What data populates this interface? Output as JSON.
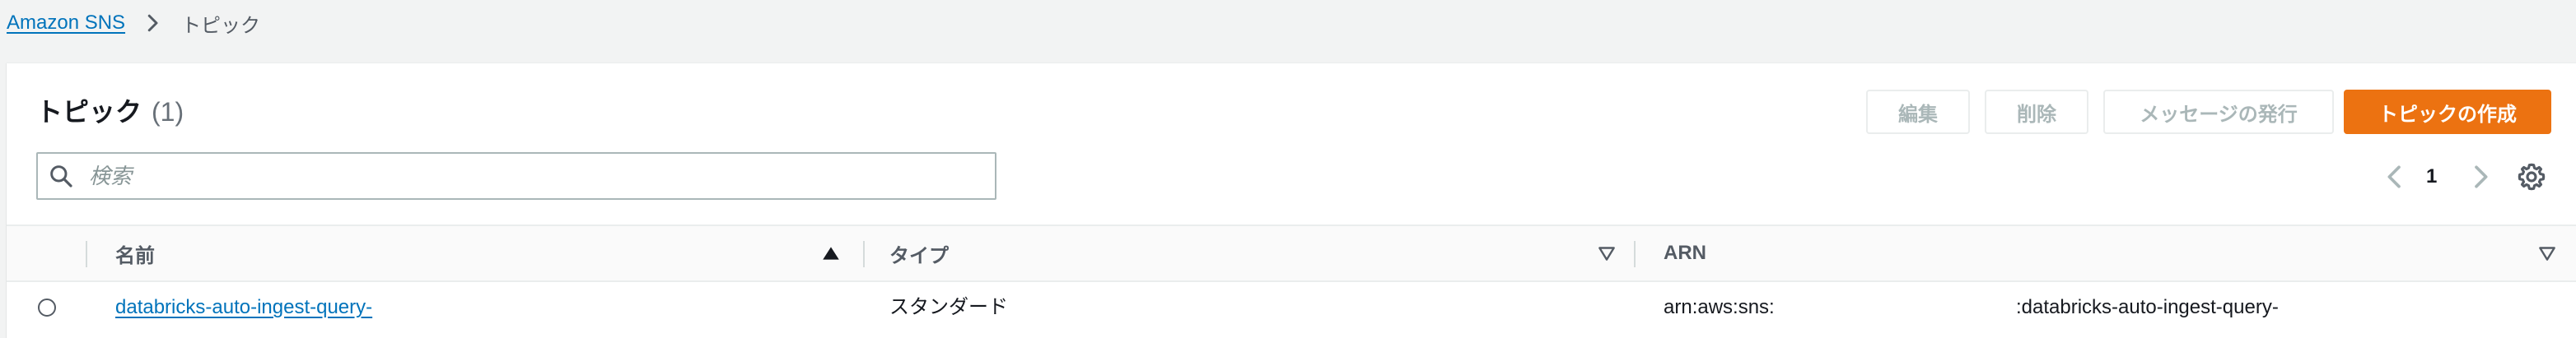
{
  "breadcrumb": {
    "root": "Amazon SNS",
    "separator_icon": "chevron-right-icon",
    "current": "トピック"
  },
  "panel": {
    "title": "トピック",
    "count": "(1)"
  },
  "actions": {
    "edit": "編集",
    "delete": "削除",
    "publish": "メッセージの発行",
    "create": "トピックの作成"
  },
  "search": {
    "placeholder": "検索",
    "value": ""
  },
  "pagination": {
    "current_page": "1"
  },
  "table": {
    "columns": [
      {
        "label": "名前",
        "sort": "ascending"
      },
      {
        "label": "タイプ",
        "sort": "none"
      },
      {
        "label": "ARN",
        "sort": "none"
      }
    ],
    "rows": [
      {
        "name": "databricks-auto-ingest-query-",
        "type": "スタンダード",
        "arn_prefix": "arn:aws:sns:",
        "arn_suffix": ":databricks-auto-ingest-query-"
      }
    ]
  },
  "colors": {
    "primary": "#ec7211",
    "link": "#0073bb",
    "disabled_text": "#aab7b8",
    "background": "#f2f3f3"
  }
}
